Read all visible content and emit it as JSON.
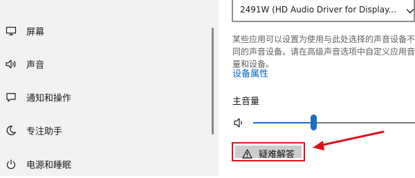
{
  "sidebar": {
    "items": [
      {
        "label": "屏幕",
        "icon": "monitor-icon"
      },
      {
        "label": "声音",
        "icon": "speaker-icon"
      },
      {
        "label": "通知和操作",
        "icon": "notification-icon"
      },
      {
        "label": "专注助手",
        "icon": "moon-icon"
      },
      {
        "label": "电源和睡眠",
        "icon": "power-icon"
      }
    ]
  },
  "output": {
    "device_value": "2491W (HD Audio Driver for Display...",
    "description": "某些应用可以设置为使用与此处选择的声音设备不同的声音设备。请在高级声音选项中自定义应用音量和设备。",
    "device_properties_link": "设备属性"
  },
  "volume": {
    "title": "主音量",
    "level_percent": 37
  },
  "troubleshoot": {
    "label": "疑难解答",
    "highlight_color": "#e0101b"
  },
  "colors": {
    "accent": "#1a6fc0",
    "link": "#0067c0",
    "sidebar_bg": "#f2f2f2"
  }
}
